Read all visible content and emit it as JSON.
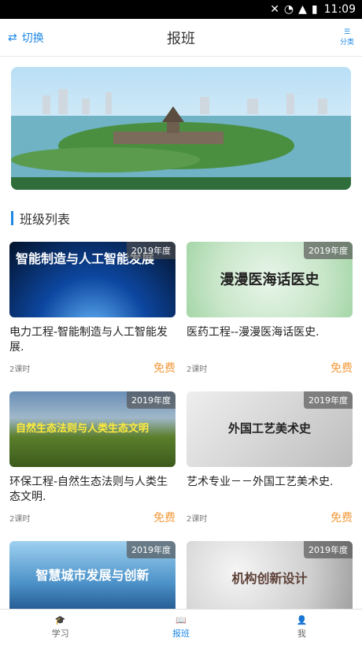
{
  "status": {
    "time": "11:09"
  },
  "header": {
    "switch_label": "切换",
    "title": "报班",
    "category_label": "分类"
  },
  "section": {
    "title": "班级列表"
  },
  "courses": [
    {
      "thumb_text": "智能制造与人工智能发展",
      "year": "2019年度",
      "title": "电力工程-智能制造与人工智能发展.",
      "hours": "2课时",
      "price": "免费"
    },
    {
      "thumb_text": "漫漫医海话医史",
      "year": "2019年度",
      "title": "医药工程--漫漫医海话医史.",
      "hours": "2课时",
      "price": "免费"
    },
    {
      "thumb_text": "自然生态法则与人类生态文明",
      "year": "2019年度",
      "title": "环保工程-自然生态法则与人类生态文明.",
      "hours": "2课时",
      "price": "免费"
    },
    {
      "thumb_text": "外国工艺美术史",
      "year": "2019年度",
      "title": "艺术专业－－外国工艺美术史.",
      "hours": "2课时",
      "price": "免费"
    },
    {
      "thumb_text": "智慧城市发展与创新",
      "year": "2019年度",
      "title": "",
      "hours": "",
      "price": ""
    },
    {
      "thumb_text": "机构创新设计",
      "year": "2019年度",
      "title": "",
      "hours": "",
      "price": ""
    }
  ],
  "tabs": [
    {
      "label": "学习"
    },
    {
      "label": "报班"
    },
    {
      "label": "我"
    }
  ],
  "colors": {
    "accent": "#1e88e5",
    "free": "#f39a3b"
  }
}
